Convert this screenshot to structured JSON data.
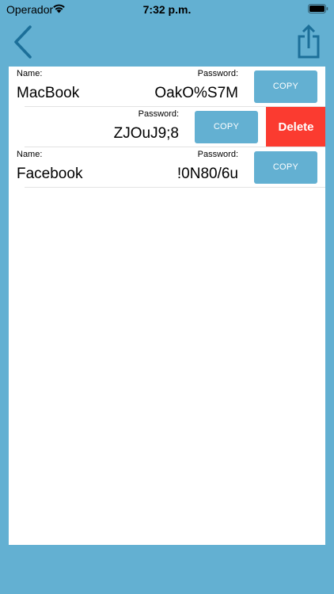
{
  "status_bar": {
    "carrier": "Operador",
    "time": "7:32 p.m."
  },
  "nav": {
    "back_icon": "chevron-left-icon",
    "share_icon": "share-icon"
  },
  "colors": {
    "background": "#63b0d2",
    "panel": "#ffffff",
    "copy_button": "#63b0d2",
    "delete_button": "#fb3b30",
    "icon": "#1c6f99"
  },
  "entries": [
    {
      "name_label": "Name:",
      "name": "MacBook",
      "password_label": "Password:",
      "password": "OakO%S7M",
      "copy_label": "COPY"
    },
    {
      "password_label": "Password:",
      "password": "ZJOuJ9;8",
      "copy_label": "COPY",
      "delete_label": "Delete"
    },
    {
      "name_label": "Name:",
      "name": "Facebook",
      "password_label": "Password:",
      "password": "!0N80/6u",
      "copy_label": "COPY"
    }
  ]
}
